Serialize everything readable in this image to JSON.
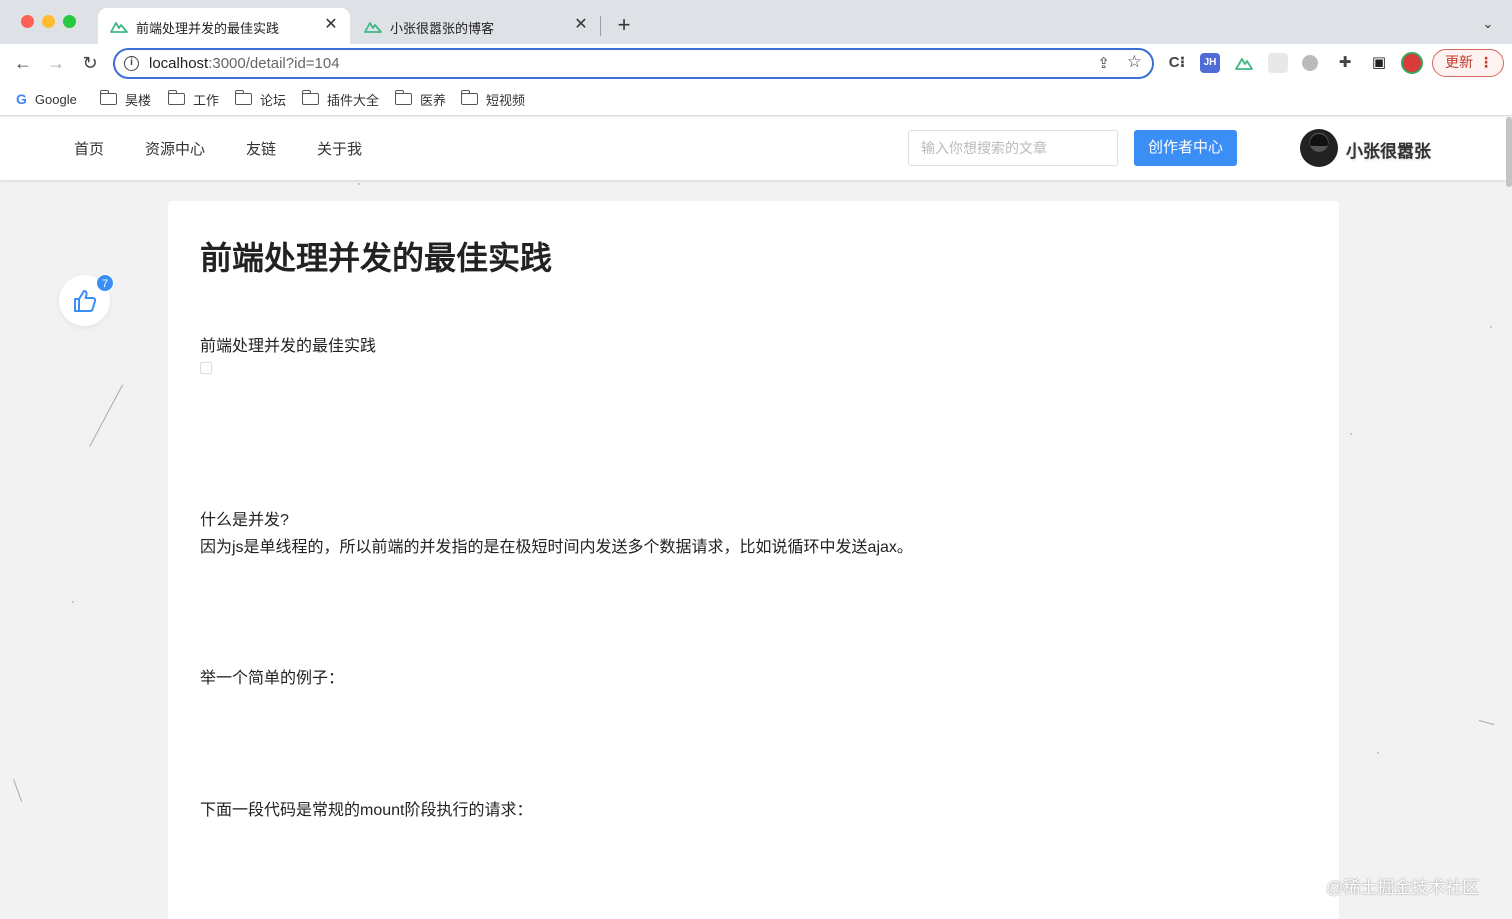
{
  "browser": {
    "tabs": [
      {
        "title": "前端处理并发的最佳实践",
        "active": true
      },
      {
        "title": "小张很嚣张的博客",
        "active": false
      }
    ],
    "url_host": "localhost",
    "url_path": ":3000/detail?id=104",
    "update_label": "更新",
    "extensions": [
      "C⁝",
      "JH",
      "nuxt-icon",
      "grid-icon",
      "circle-icon",
      "puzzle-icon",
      "sidepanel-icon"
    ],
    "bookmarks": [
      "Google",
      "昊楼",
      "工作",
      "论坛",
      "插件大全",
      "医养",
      "短视频"
    ]
  },
  "site": {
    "nav": [
      "首页",
      "资源中心",
      "友链",
      "关于我"
    ],
    "search_placeholder": "输入你想搜索的文章",
    "creator_button": "创作者中心",
    "username": "小张很嚣张"
  },
  "like_count": "7",
  "article": {
    "title": "前端处理并发的最佳实践",
    "paragraphs": [
      "前端处理并发的最佳实践",
      "什么是并发?",
      "因为js是单线程的，所以前端的并发指的是在极短时间内发送多个数据请求，比如说循环中发送ajax。",
      "举一个简单的例子：",
      "下面一段代码是常规的mount阶段执行的请求："
    ]
  },
  "watermark": "@稀土掘金技术社区",
  "colors": {
    "accent": "#3a8ef6",
    "nuxt_green": "#41b883"
  }
}
